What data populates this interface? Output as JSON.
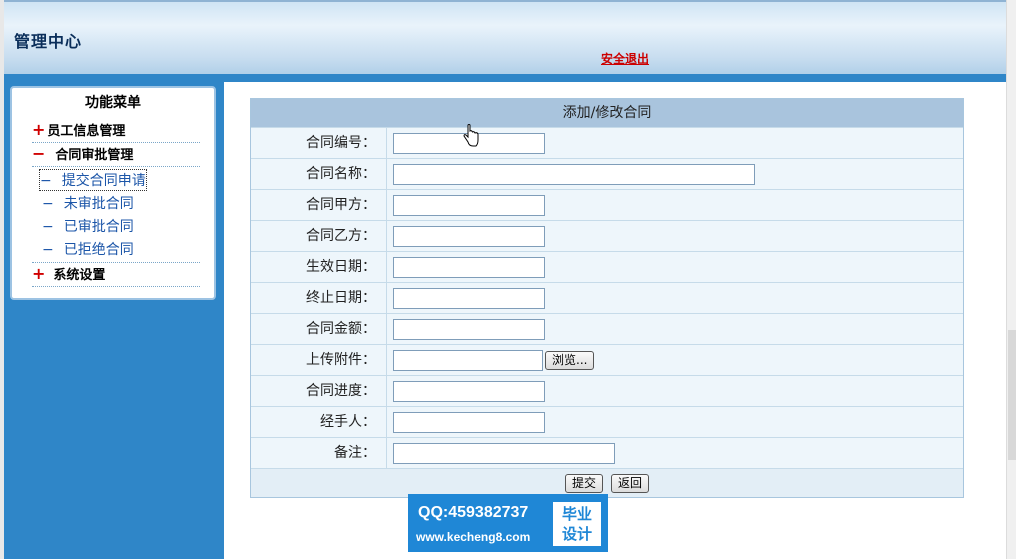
{
  "header": {
    "title": "管理中心",
    "logout": "安全退出"
  },
  "sidebar": {
    "menu_title": "功能菜单",
    "sections": [
      {
        "label": "员工信息管理",
        "expanded": false,
        "symbol": "+"
      },
      {
        "label": "合同审批管理",
        "expanded": true,
        "symbol": "−"
      },
      {
        "label": "系统设置",
        "expanded": false,
        "symbol": "+"
      }
    ],
    "sub_items": [
      {
        "label": "提交合同申请",
        "dash": "−"
      },
      {
        "label": "未审批合同",
        "dash": "−"
      },
      {
        "label": "已审批合同",
        "dash": "−"
      },
      {
        "label": "已拒绝合同",
        "dash": "−"
      }
    ]
  },
  "form": {
    "title": "添加/修改合同",
    "fields": [
      {
        "label": "合同编号：",
        "value": ""
      },
      {
        "label": "合同名称：",
        "value": ""
      },
      {
        "label": "合同甲方：",
        "value": ""
      },
      {
        "label": "合同乙方：",
        "value": ""
      },
      {
        "label": "生效日期：",
        "value": ""
      },
      {
        "label": "终止日期：",
        "value": ""
      },
      {
        "label": "合同金额：",
        "value": ""
      },
      {
        "label": "上传附件：",
        "value": "",
        "browse": "浏览..."
      },
      {
        "label": "合同进度：",
        "value": ""
      },
      {
        "label": "经手人：",
        "value": ""
      },
      {
        "label": "备注：",
        "value": ""
      }
    ],
    "submit": "提交",
    "back": "返回"
  },
  "watermark": {
    "qq": "QQ:459382737",
    "url": "www.kecheng8.com",
    "badge_line1": "毕业",
    "badge_line2": "设计"
  },
  "colors": {
    "sidebar_bg": "#2f86c8",
    "form_header_bg": "#a9c4dd",
    "logout": "#cc0000",
    "accent_plus": "#d00000"
  }
}
